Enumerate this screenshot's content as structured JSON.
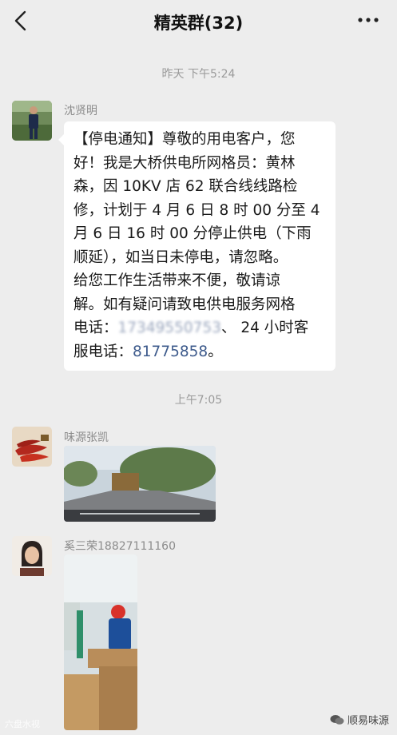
{
  "header": {
    "title": "精英群(32)"
  },
  "timestamps": {
    "first": "昨天 下午5:24",
    "second": "上午7:05"
  },
  "messages": [
    {
      "sender": "沈贤明",
      "lines": [
        "【停电通知】尊敬的用电客户，您",
        "好！我是大桥供电所网格员：黄林",
        "森，因 10KV 店 62 联合线线路检",
        "修，计划于 4 月 6 日 8 时 00 分至 4",
        "月 6 日 16 时 00 分停止供电（下雨",
        "顺延），如当日未停电，请忽略。",
        "给您工作生活带来不便，敬请谅",
        "解。如有疑问请致电供电服务网格"
      ],
      "line9_prefix": "电话：",
      "line9_phone": "17349550753",
      "line9_suffix": "、 24 小时客",
      "line10_prefix": "服电话：",
      "line10_phone": "81775858",
      "line10_suffix": "。"
    },
    {
      "sender": "味源张凯"
    },
    {
      "sender": "奚三荣18827111160"
    }
  ],
  "watermarks": {
    "left": "六盘水视",
    "right": "顺易味源"
  }
}
